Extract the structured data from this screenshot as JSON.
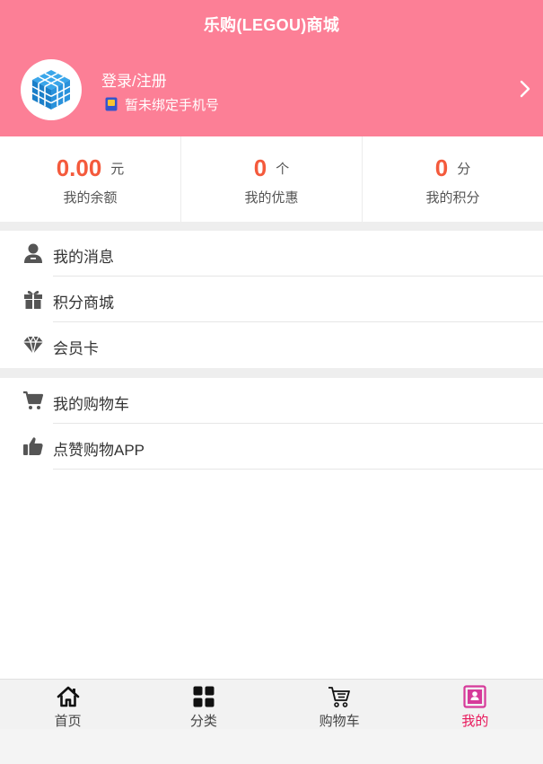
{
  "header": {
    "title": "乐购(LEGOU)商城",
    "login_label": "登录/注册",
    "phone_status": "暂未绑定手机号",
    "arrow_icon": "chevron-right-icon",
    "avatar_icon": "cube-logo-icon"
  },
  "stats": [
    {
      "value": "0.00",
      "unit": "元",
      "label": "我的余额"
    },
    {
      "value": "0",
      "unit": "个",
      "label": "我的优惠"
    },
    {
      "value": "0",
      "unit": "分",
      "label": "我的积分"
    }
  ],
  "menu_group_1": [
    {
      "label": "我的消息",
      "icon": "user-icon"
    },
    {
      "label": "积分商城",
      "icon": "gift-icon"
    },
    {
      "label": "会员卡",
      "icon": "diamond-icon"
    }
  ],
  "menu_group_2": [
    {
      "label": "我的购物车",
      "icon": "cart-icon"
    },
    {
      "label": "点赞购物APP",
      "icon": "thumbs-up-icon"
    }
  ],
  "tabbar": [
    {
      "label": "首页",
      "icon": "home-icon",
      "active": false
    },
    {
      "label": "分类",
      "icon": "grid-icon",
      "active": false
    },
    {
      "label": "购物车",
      "icon": "cart-outline-icon",
      "active": false
    },
    {
      "label": "我的",
      "icon": "profile-icon",
      "active": true
    }
  ],
  "colors": {
    "header_bg": "#fc7f96",
    "stat_value": "#f45a3c",
    "active_tab": "#e8185b",
    "active_tab_icon": "#d63a9a"
  }
}
